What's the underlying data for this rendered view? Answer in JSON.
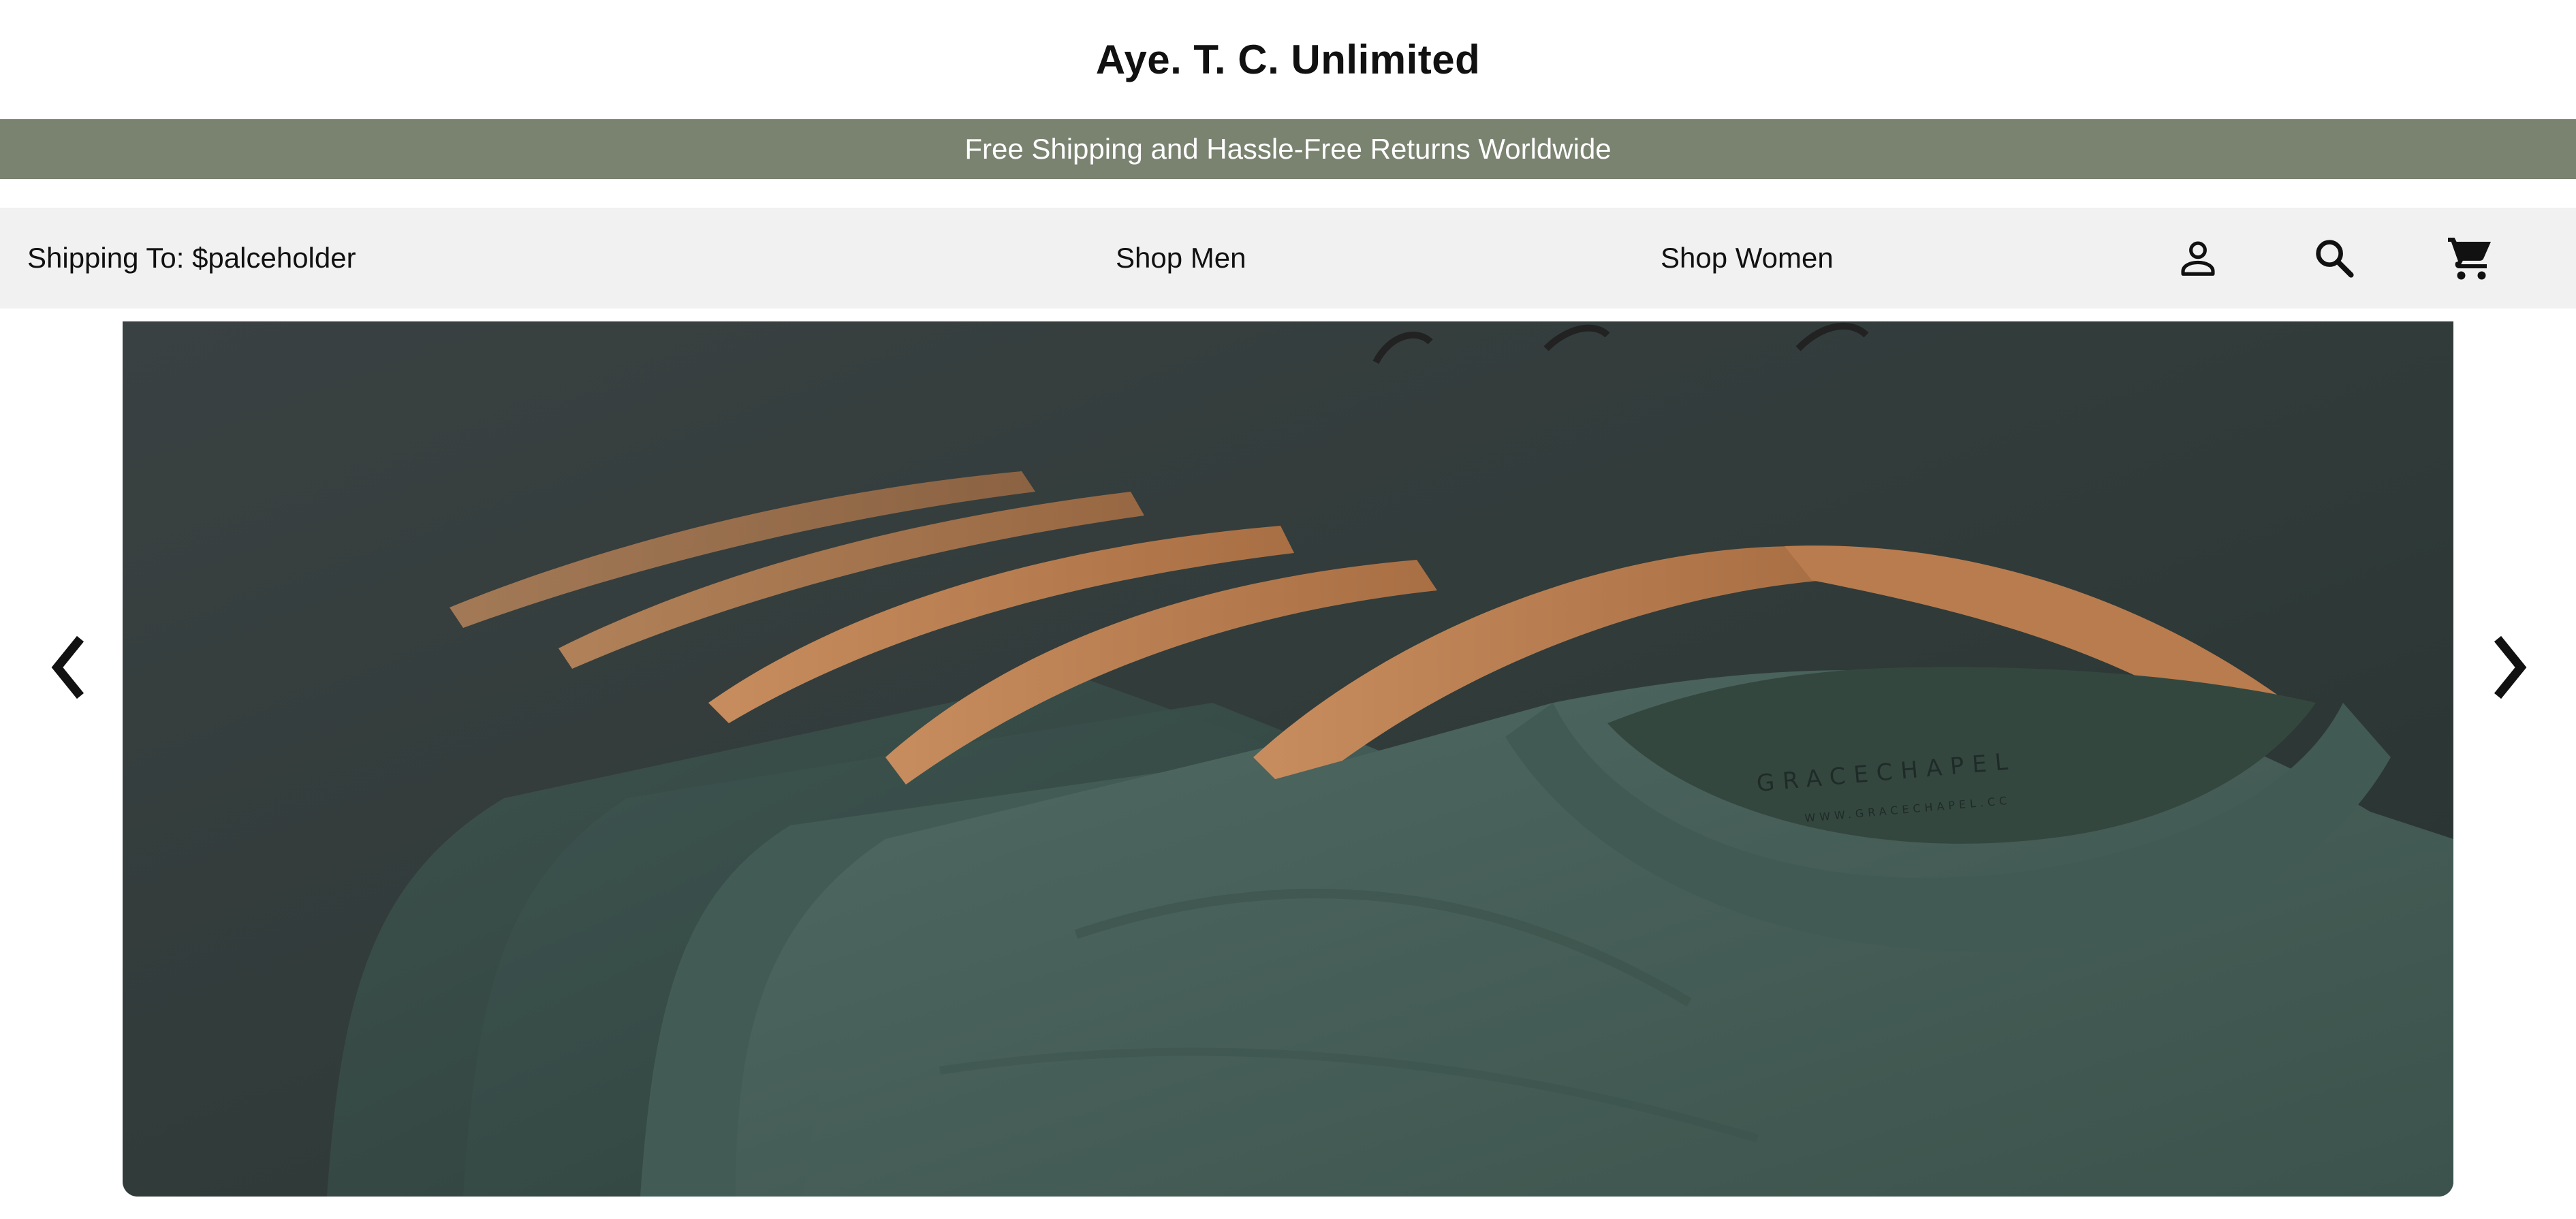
{
  "brand": {
    "title": "Aye. T. C. Unlimited"
  },
  "promo": {
    "text": "Free Shipping and Hassle-Free Returns Worldwide",
    "color": "#7a8370"
  },
  "nav": {
    "shipping_label": "Shipping To: $palceholder",
    "links": [
      "Shop Men",
      "Shop Women"
    ],
    "icons": [
      "user-icon",
      "search-icon",
      "cart-icon"
    ]
  },
  "hero": {
    "image": "photo of green t-shirts on wooden hangers",
    "label_brand": "GRACECHAPEL",
    "label_url": "WWW.GRACECHAPEL.CC",
    "prev_icon": "chevron-left-icon",
    "next_icon": "chevron-right-icon"
  }
}
